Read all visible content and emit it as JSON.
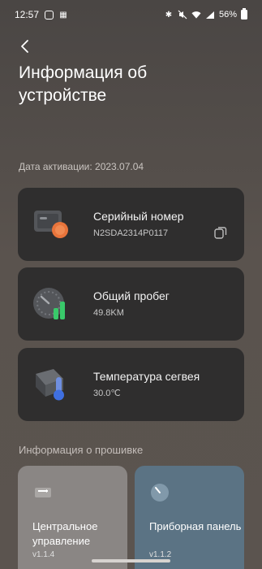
{
  "status_bar": {
    "time": "12:57",
    "battery": "56%"
  },
  "header": {
    "back_icon": "chevron-left-icon",
    "title": "Информация об устройстве"
  },
  "activation": {
    "text": "Дата активации: 2023.07.04"
  },
  "cards": [
    {
      "title": "Серийный номер",
      "value": "N2SDA2314P0117",
      "icon": "device-serial-icon"
    },
    {
      "title": "Общий пробег",
      "value": "49.8KM",
      "icon": "gauge-icon"
    },
    {
      "title": "Температура сегвея",
      "value": "30.0℃",
      "icon": "thermometer-icon"
    }
  ],
  "firmware": {
    "section_title": "Информация о прошивке",
    "tiles": [
      {
        "title": "Центральное управление",
        "version": "v1.1.4"
      },
      {
        "title": "Приборная панель",
        "version": "v1.1.2"
      }
    ]
  },
  "colors": {
    "card_bg": "#2f2e2e",
    "accent_orange": "#e8743b",
    "accent_green": "#39c96a",
    "accent_blue": "#3f6fe0"
  }
}
